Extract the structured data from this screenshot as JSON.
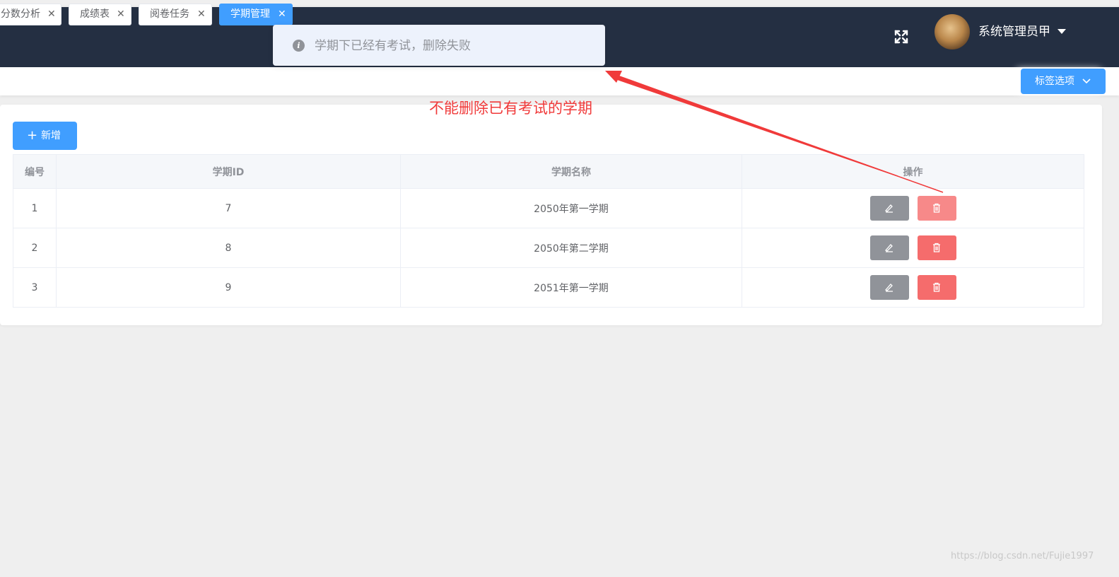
{
  "header": {
    "username": "系统管理员甲",
    "fullscreen_icon": "fullscreen-icon",
    "avatar_icon": "avatar-dog"
  },
  "tags": {
    "items": [
      {
        "label": "分数分析"
      },
      {
        "label": "成绩表"
      },
      {
        "label": "阅卷任务"
      },
      {
        "label": "学期管理",
        "active": true
      }
    ],
    "close_glyph": "✕",
    "options_label": "标签选项",
    "options_icon": "chevron-down-icon"
  },
  "toolbar": {
    "add_label": "新增",
    "add_icon": "plus-icon"
  },
  "table": {
    "headers": [
      "编号",
      "学期ID",
      "学期名称",
      "操作"
    ],
    "rows": [
      {
        "no": "1",
        "id": "7",
        "name": "2050年第一学期"
      },
      {
        "no": "2",
        "id": "8",
        "name": "2050年第二学期"
      },
      {
        "no": "3",
        "id": "9",
        "name": "2051年第一学期"
      }
    ],
    "edit_icon": "pencil-icon",
    "delete_icon": "trash-icon"
  },
  "toast": {
    "message": "学期下已经有考试，删除失败",
    "icon": "info-icon"
  },
  "annotation": {
    "text": "不能删除已有考试的学期",
    "color": "#f03a3a"
  },
  "watermark": "https://blog.csdn.net/Fujie1997",
  "colors": {
    "primary": "#409eff",
    "header_bg": "#242f42",
    "danger": "#f56c6c",
    "info": "#909399"
  }
}
